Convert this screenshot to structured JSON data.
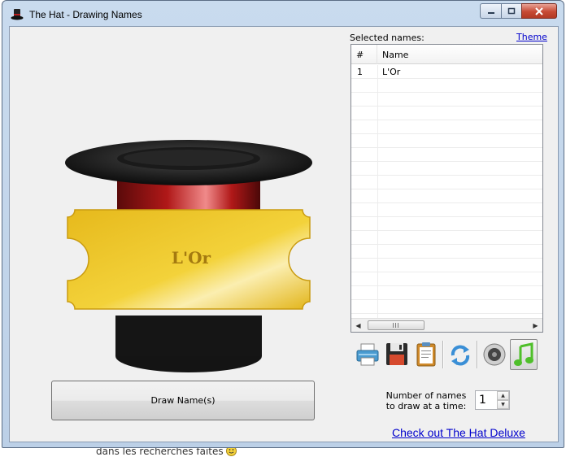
{
  "window": {
    "title": "The Hat - Drawing Names"
  },
  "hat": {
    "ticket_name": "L'Or"
  },
  "list": {
    "label": "Selected names:",
    "theme_link": "Theme",
    "columns": [
      "#",
      "Name"
    ],
    "rows": [
      {
        "num": "1",
        "name": "L'Or"
      }
    ],
    "scroll_grip": "III"
  },
  "toolbar": {
    "icons": [
      "printer-icon",
      "save-icon",
      "clipboard-icon",
      "refresh-icon",
      "speaker-icon",
      "music-note-icon"
    ]
  },
  "draw": {
    "button_label": "Draw Name(s)",
    "count_label_line1": "Number of names",
    "count_label_line2": "to draw at a time:",
    "count_value": "1"
  },
  "links": {
    "deluxe": "Check out The Hat Deluxe"
  },
  "background": {
    "text": "dans les recherches faites"
  }
}
